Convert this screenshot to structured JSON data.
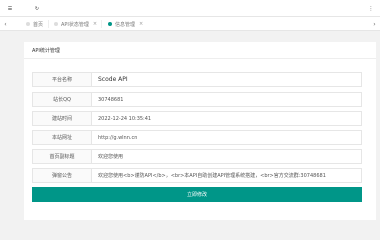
{
  "topbar": {
    "menu_icon": "☰",
    "refresh_icon": "↻",
    "more_icon": "⋮"
  },
  "tabs": {
    "left_arrow": "‹",
    "right_arrow": "›",
    "items": [
      {
        "label": "首页"
      },
      {
        "label": "API状态管理"
      },
      {
        "label": "信息管理"
      }
    ],
    "close_glyph": "×"
  },
  "card": {
    "title": "API统计管理",
    "fields": [
      {
        "label": "平台名称",
        "value": "Scode API"
      },
      {
        "label": "站长QQ",
        "value": "30748681"
      },
      {
        "label": "建站时间",
        "value": "2022-12-24 10:35:41"
      },
      {
        "label": "本站网址",
        "value": "http://g.wlnn.cn"
      },
      {
        "label": "首页副标题",
        "value": "欢迎您使用"
      },
      {
        "label": "弹窗公告",
        "value": "欢迎您使用<b>谨防API</b>，<br>本API自助创建API管理系统搭建，<br>官方交流群:30748681"
      }
    ],
    "submit_label": "立即修改"
  },
  "colors": {
    "accent": "#009688"
  }
}
